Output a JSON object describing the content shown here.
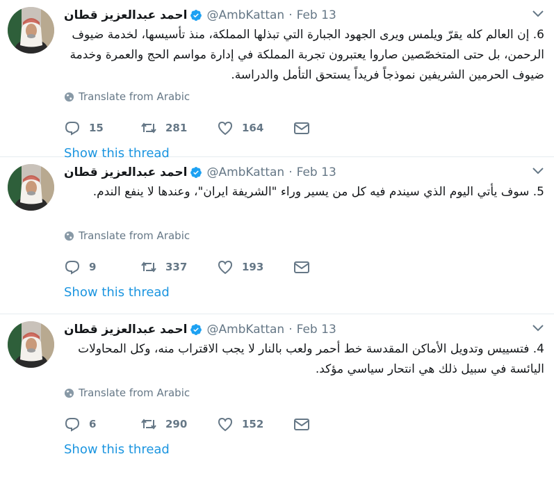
{
  "accent_color": "#1b95e0",
  "muted_color": "#657786",
  "tweets": [
    {
      "author_name": "احمد عبدالعزيز قطان",
      "handle": "@AmbKattan",
      "separator": "·",
      "date": "Feb 13",
      "text": "6. إن العالم كله يقرّ ويلمس ويرى الجهود الجبارة التي تبذلها المملكة، منذ تأسيسها، لخدمة ضيوف الرحمن، بل حتى المتخصّصين صاروا يعتبرون تجربة المملكة في إدارة مواسم الحج والعمرة وخدمة ضيوف الحرمين الشريفين نموذجاً فريداً يستحق التأمل والدراسة.",
      "translate_label": "Translate from Arabic",
      "replies": "15",
      "retweets": "281",
      "likes": "164",
      "show_thread": "Show this thread"
    },
    {
      "author_name": "احمد عبدالعزيز قطان",
      "handle": "@AmbKattan",
      "separator": "·",
      "date": "Feb 13",
      "text": "5. سوف يأتي اليوم الذي سيندم فيه كل من يسير وراء \"الشريفة ايران\"، وعندها لا ينفع الندم.",
      "translate_label": "Translate from Arabic",
      "replies": "9",
      "retweets": "337",
      "likes": "193",
      "show_thread": "Show this thread"
    },
    {
      "author_name": "احمد عبدالعزيز قطان",
      "handle": "@AmbKattan",
      "separator": "·",
      "date": "Feb 13",
      "text": "4. فتسييس وتدويل الأماكن المقدسة خط أحمر ولعب بالنار لا يجب الاقتراب منه، وكل المحاولات اليائسة في سبيل ذلك هي انتحار سياسي مؤكد.",
      "translate_label": "Translate from Arabic",
      "replies": "6",
      "retweets": "290",
      "likes": "152",
      "show_thread": "Show this thread"
    }
  ]
}
